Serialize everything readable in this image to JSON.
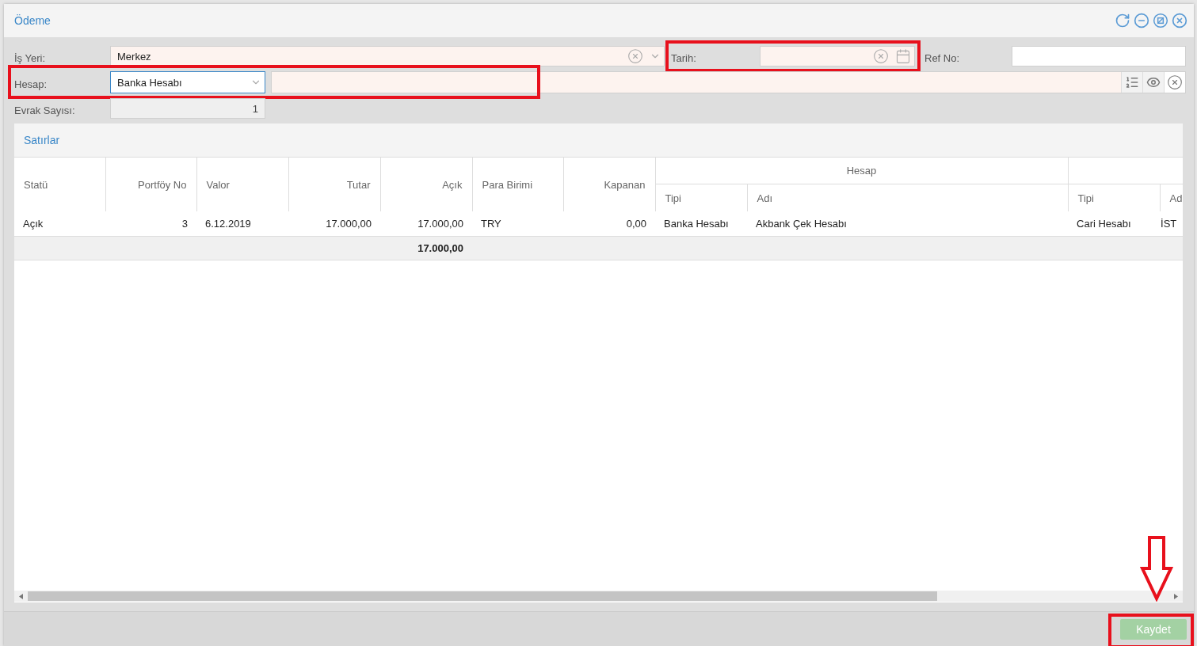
{
  "window": {
    "title": "Ödeme"
  },
  "form": {
    "is_yeri": {
      "label": "İş Yeri:",
      "value": "Merkez"
    },
    "tarih": {
      "label": "Tarih:",
      "highlighted": true
    },
    "ref_no": {
      "label": "Ref No:"
    },
    "hesap": {
      "label": "Hesap:",
      "value": "Banka Hesabı",
      "highlighted": true
    },
    "evrak_sayisi": {
      "label": "Evrak Sayısı:",
      "value": "1"
    }
  },
  "grid": {
    "title": "Satırlar",
    "columns": [
      {
        "label": "Statü"
      },
      {
        "label": "Portföy No"
      },
      {
        "label": "Valor"
      },
      {
        "label": "Tutar"
      },
      {
        "label": "Açık",
        "total": "17.000,00"
      },
      {
        "label": "Para Birimi"
      },
      {
        "label": "Kapanan"
      },
      {
        "label": "Tipi"
      },
      {
        "label": "Adı"
      },
      {
        "label": "Tipi"
      },
      {
        "label": "Ad"
      }
    ],
    "column_groups": [
      {
        "label": "Hesap"
      }
    ],
    "rows": [
      [
        "Açık",
        "3",
        "6.12.2019",
        "17.000,00",
        "17.000,00",
        "TRY",
        "0,00",
        "Banka Hesabı",
        "Akbank Çek Hesabı",
        "Cari Hesabı",
        "İST"
      ]
    ]
  },
  "footer": {
    "save_button": {
      "label": "Kaydet",
      "disabled": true,
      "highlighted": true,
      "arrow": true
    }
  }
}
